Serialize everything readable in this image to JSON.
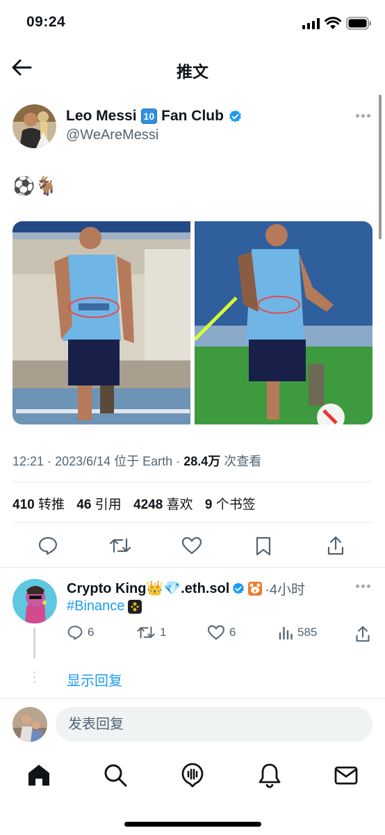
{
  "status": {
    "time": "09:24"
  },
  "header": {
    "title": "推文"
  },
  "author": {
    "name": "Leo Messi",
    "badge": "10",
    "name_suffix": "Fan Club",
    "handle": "@WeAreMessi"
  },
  "tweet": {
    "text": "⚽🐐"
  },
  "meta": {
    "time": "12:21",
    "date": "2023/6/14",
    "location": "位于 Earth",
    "views": "28.4万",
    "views_label": "次查看"
  },
  "stats": [
    {
      "value": "410",
      "label": "转推"
    },
    {
      "value": "46",
      "label": "引用"
    },
    {
      "value": "4248",
      "label": "喜欢"
    },
    {
      "value": "9",
      "label": "个书签"
    }
  ],
  "reply": {
    "name": "Crypto King👑💎.eth.sol",
    "time": "·4小时",
    "hashtag": "#Binance",
    "replies": "6",
    "retweets": "1",
    "likes": "6",
    "views": "585",
    "show_replies": "显示回复"
  },
  "composer": {
    "placeholder": "发表回复"
  },
  "icons": {
    "back": "arrow-left-icon",
    "verified": "verified-badge-icon",
    "more": "more-icon",
    "reply": "reply-icon",
    "retweet": "retweet-icon",
    "like": "heart-icon",
    "bookmark": "bookmark-icon",
    "share": "share-icon",
    "views": "analytics-icon",
    "home": "home-icon",
    "search": "search-icon",
    "spaces": "spaces-icon",
    "notifications": "bell-icon",
    "messages": "mail-icon"
  },
  "colors": {
    "accent": "#1d9bf0",
    "text": "#0f1419",
    "secondary": "#536471",
    "divider": "#e7e9ea"
  }
}
